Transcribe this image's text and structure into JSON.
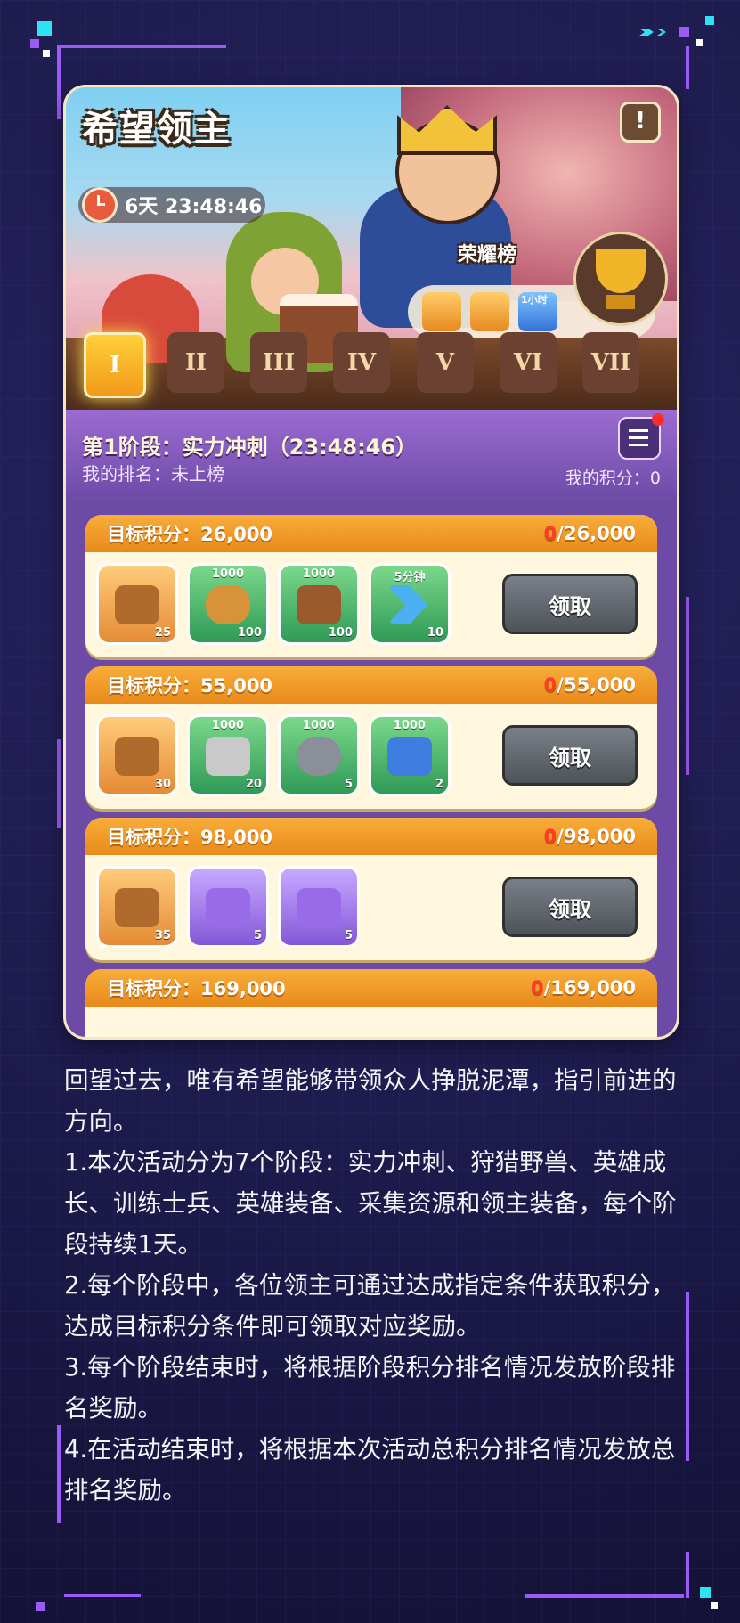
{
  "event": {
    "title": "希望领主",
    "timer": "6天 23:48:46",
    "honor_label": "荣耀榜",
    "honor_item_badge": "1小时",
    "stages": [
      "I",
      "II",
      "III",
      "IV",
      "V",
      "VI",
      "VII"
    ],
    "active_stage_index": 0
  },
  "phase": {
    "title": "第1阶段：实力冲刺（23:48:46）",
    "rank": "我的排名：未上榜",
    "score": "我的积分：0"
  },
  "rewards": [
    {
      "label": "目标积分：26,000",
      "progress_current": "0",
      "progress_total": "/26,000",
      "claim_label": "领取",
      "items": [
        {
          "kind": "chest",
          "top": "",
          "count": "25",
          "icon": "food-chest-icon"
        },
        {
          "kind": "green",
          "top": "1000",
          "count": "100",
          "icon": "bread-icon"
        },
        {
          "kind": "green",
          "top": "1000",
          "count": "100",
          "icon": "wood-icon"
        },
        {
          "kind": "green",
          "top": "5分钟",
          "count": "10",
          "icon": "speedup-icon"
        }
      ]
    },
    {
      "label": "目标积分：55,000",
      "progress_current": "0",
      "progress_total": "/55,000",
      "claim_label": "领取",
      "items": [
        {
          "kind": "chest",
          "top": "",
          "count": "30",
          "icon": "food-chest-icon"
        },
        {
          "kind": "green",
          "top": "1000",
          "count": "20",
          "icon": "stone-icon"
        },
        {
          "kind": "green",
          "top": "1000",
          "count": "5",
          "icon": "iron-icon"
        },
        {
          "kind": "green",
          "top": "1000",
          "count": "2",
          "icon": "mana-potion-icon"
        }
      ]
    },
    {
      "label": "目标积分：98,000",
      "progress_current": "0",
      "progress_total": "/98,000",
      "claim_label": "领取",
      "items": [
        {
          "kind": "chest",
          "top": "",
          "count": "35",
          "icon": "food-chest-icon"
        },
        {
          "kind": "purple",
          "top": "",
          "count": "5",
          "icon": "purple-book-icon"
        },
        {
          "kind": "purple",
          "top": "",
          "count": "5",
          "icon": "purple-book-icon"
        }
      ]
    },
    {
      "label": "目标积分：169,000",
      "progress_current": "0",
      "progress_total": "/169,000"
    }
  ],
  "description": [
    "回望过去，唯有希望能够带领众人挣脱泥潭，指引前进的方向。",
    "1.本次活动分为7个阶段：实力冲刺、狩猎野兽、英雄成长、训练士兵、英雄装备、采集资源和领主装备，每个阶段持续1天。",
    "2.每个阶段中，各位领主可通过达成指定条件获取积分，达成目标积分条件即可领取对应奖励。",
    "3.每个阶段结束时，将根据阶段积分排名情况发放阶段排名奖励。",
    "4.在活动结束时，将根据本次活动总积分排名情况发放总排名奖励。"
  ],
  "colors": {
    "accent_orange": "#f29a1a",
    "purple": "#6d4aa6",
    "claim_gray": "#5f646b",
    "zero_red": "#ff3b2a"
  }
}
